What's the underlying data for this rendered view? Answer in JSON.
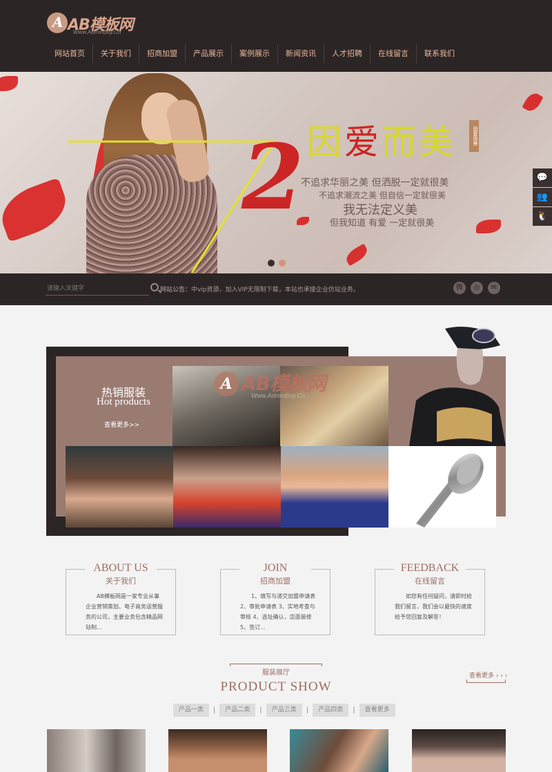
{
  "header": {
    "logo_text": "AB模板网",
    "logo_sub": "Www.AdminBuy.Cn",
    "nav": [
      "网站首页",
      "关于我们",
      "招商加盟",
      "产品展示",
      "案例展示",
      "新闻资讯",
      "人才招聘",
      "在线留言",
      "联系我们"
    ]
  },
  "banner": {
    "big_number": "2",
    "slogan_pre": "因",
    "slogan_ai": "爱",
    "slogan_post": "而美",
    "slogan_tag": "因爱而美",
    "line1": "不追求华丽之美  但洒脱一定就很美",
    "line2": "不追求潮流之美  但自信一定就很美",
    "line3": "我无法定义美",
    "line4": "但我知道  有爱  一定就很美",
    "active_slide": 2,
    "slide_count": 2
  },
  "side_tools": [
    "wechat-icon",
    "user-icon",
    "qq-icon"
  ],
  "search": {
    "placeholder": "请输入关键字",
    "notice_label": "网站公告：",
    "notice_text": "中vip资源，加入VIP无限制下载，本站也承接企业仿站业务。"
  },
  "social": [
    "weibo-icon",
    "weibo-circle-icon",
    "wechat-icon"
  ],
  "hot_products": {
    "title_cn": "热销服装",
    "title_en": "Hot products",
    "more": "查看更多>>",
    "watermark": "AB模板网",
    "watermark_sub": "Www.AdminBuy.Cn"
  },
  "info_boxes": [
    {
      "en": "ABOUT US",
      "cn": "关于我们",
      "text": "AB模板网是一家专业从事企业营销策划、电子商务运营服务的公司，主要业务包含精品网站制..."
    },
    {
      "en": "JOIN",
      "cn": "招商加盟",
      "text": "1、填写与递交加盟申请表 2、审批申请表 3、实地考查与审核 4、选址确认，店面装修 5、签订..."
    },
    {
      "en": "FEEDBACK",
      "cn": "在线留言",
      "text": "如您有任何疑问，请即时给我们留言，我们会以最快的速度给予您回复及解答！"
    }
  ],
  "product_show": {
    "title_cn": "服装展厅",
    "title_en": "PRODUCT SHOW",
    "more": "查看更多 › › ›",
    "tabs": [
      "产品一类",
      "产品二类",
      "产品三类",
      "产品四类",
      "查看更多"
    ]
  }
}
